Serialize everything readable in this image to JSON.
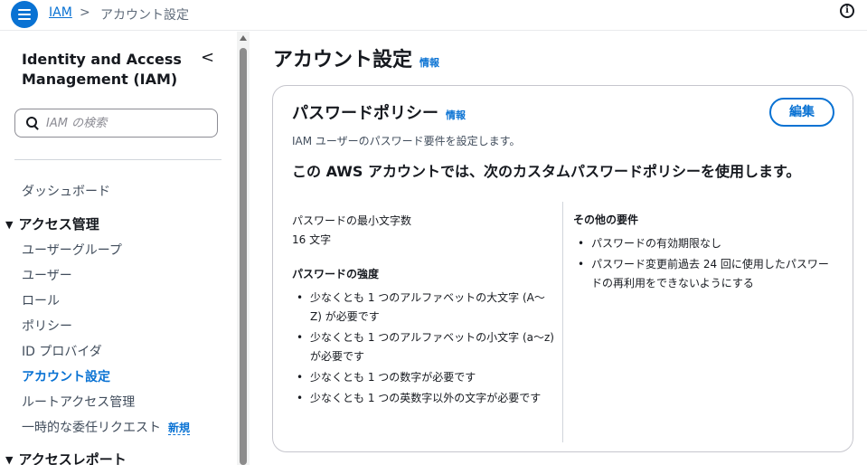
{
  "header": {
    "breadcrumb_root": "IAM",
    "breadcrumb_sep": ">",
    "breadcrumb_current": "アカウント設定"
  },
  "sidebar": {
    "title": "Identity and Access Management (IAM)",
    "collapse_glyph": "<",
    "search_placeholder": "IAM の検索",
    "items": [
      {
        "label": "ダッシュボード"
      },
      {
        "label": "アクセス管理",
        "section": true
      },
      {
        "label": "ユーザーグループ"
      },
      {
        "label": "ユーザー"
      },
      {
        "label": "ロール"
      },
      {
        "label": "ポリシー"
      },
      {
        "label": "ID プロバイダ"
      },
      {
        "label": "アカウント設定",
        "active": true
      },
      {
        "label": "ルートアクセス管理"
      },
      {
        "label": "一時的な委任リクエスト",
        "badge": "新規"
      },
      {
        "label": "アクセスレポート",
        "section": true
      }
    ]
  },
  "main": {
    "title": "アカウント設定",
    "info_label": "情報",
    "card": {
      "title": "パスワードポリシー",
      "info_label": "情報",
      "edit_label": "編集",
      "description": "IAM ユーザーのパスワード要件を設定します。",
      "heading": "この AWS アカウントでは、次のカスタムパスワードポリシーを使用します。",
      "min_length_label": "パスワードの最小文字数",
      "min_length_value": "16 文字",
      "strength_heading": "パスワードの強度",
      "strength_items": [
        "少なくとも 1 つのアルファベットの大文字 (A〜Z) が必要です",
        "少なくとも 1 つのアルファベットの小文字 (a〜z) が必要です",
        "少なくとも 1 つの数字が必要です",
        "少なくとも 1 つの英数字以外の文字が必要です"
      ],
      "other_heading": "その他の要件",
      "other_items": [
        "パスワードの有効期限なし",
        "パスワード変更前過去 24 回に使用したパスワードの再利用をできないようにする"
      ]
    }
  },
  "colors": {
    "accent": "#0972d3",
    "text": "#16191f",
    "border": "#c6c6cd"
  }
}
